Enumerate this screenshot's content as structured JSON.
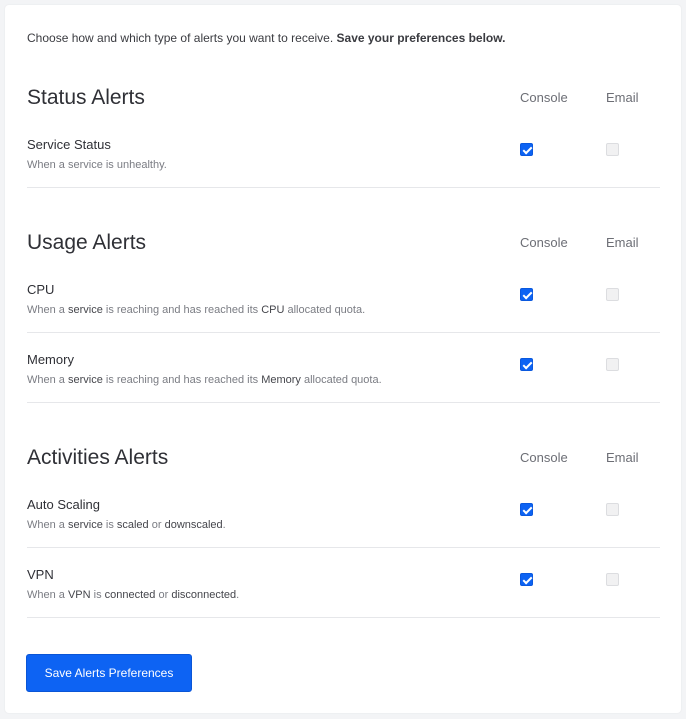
{
  "intro": {
    "text": "Choose how and which type of alerts you want to receive. ",
    "bold": "Save your preferences below."
  },
  "columns": {
    "console": "Console",
    "email": "Email"
  },
  "sections": [
    {
      "title": "Status Alerts",
      "items": [
        {
          "title": "Service Status",
          "description": [
            {
              "t": "When a service is unhealthy.",
              "hl": false
            }
          ],
          "console": true,
          "email": false,
          "email_disabled": true
        }
      ]
    },
    {
      "title": "Usage Alerts",
      "items": [
        {
          "title": "CPU",
          "description": [
            {
              "t": "When a ",
              "hl": false
            },
            {
              "t": "service",
              "hl": true
            },
            {
              "t": " is reaching and has reached its ",
              "hl": false
            },
            {
              "t": "CPU",
              "hl": true
            },
            {
              "t": " allocated quota.",
              "hl": false
            }
          ],
          "console": true,
          "email": false,
          "email_disabled": true
        },
        {
          "title": "Memory",
          "description": [
            {
              "t": "When a ",
              "hl": false
            },
            {
              "t": "service",
              "hl": true
            },
            {
              "t": " is reaching and has reached its ",
              "hl": false
            },
            {
              "t": "Memory",
              "hl": true
            },
            {
              "t": " allocated quota.",
              "hl": false
            }
          ],
          "console": true,
          "email": false,
          "email_disabled": true
        }
      ]
    },
    {
      "title": "Activities Alerts",
      "items": [
        {
          "title": "Auto Scaling",
          "description": [
            {
              "t": "When a ",
              "hl": false
            },
            {
              "t": "service",
              "hl": true
            },
            {
              "t": " is ",
              "hl": false
            },
            {
              "t": "scaled",
              "hl": true
            },
            {
              "t": " or ",
              "hl": false
            },
            {
              "t": "downscaled",
              "hl": true
            },
            {
              "t": ".",
              "hl": false
            }
          ],
          "console": true,
          "email": false,
          "email_disabled": true
        },
        {
          "title": "VPN",
          "description": [
            {
              "t": "When a ",
              "hl": false
            },
            {
              "t": "VPN",
              "hl": true
            },
            {
              "t": " is ",
              "hl": false
            },
            {
              "t": "connected",
              "hl": true
            },
            {
              "t": " or ",
              "hl": false
            },
            {
              "t": "disconnected",
              "hl": true
            },
            {
              "t": ".",
              "hl": false
            }
          ],
          "console": true,
          "email": false,
          "email_disabled": true
        }
      ]
    }
  ],
  "save_button": {
    "label": "Save Alerts Preferences"
  },
  "colors": {
    "accent": "#0d63f3",
    "background": "#f3f4f6",
    "card": "#ffffff"
  }
}
